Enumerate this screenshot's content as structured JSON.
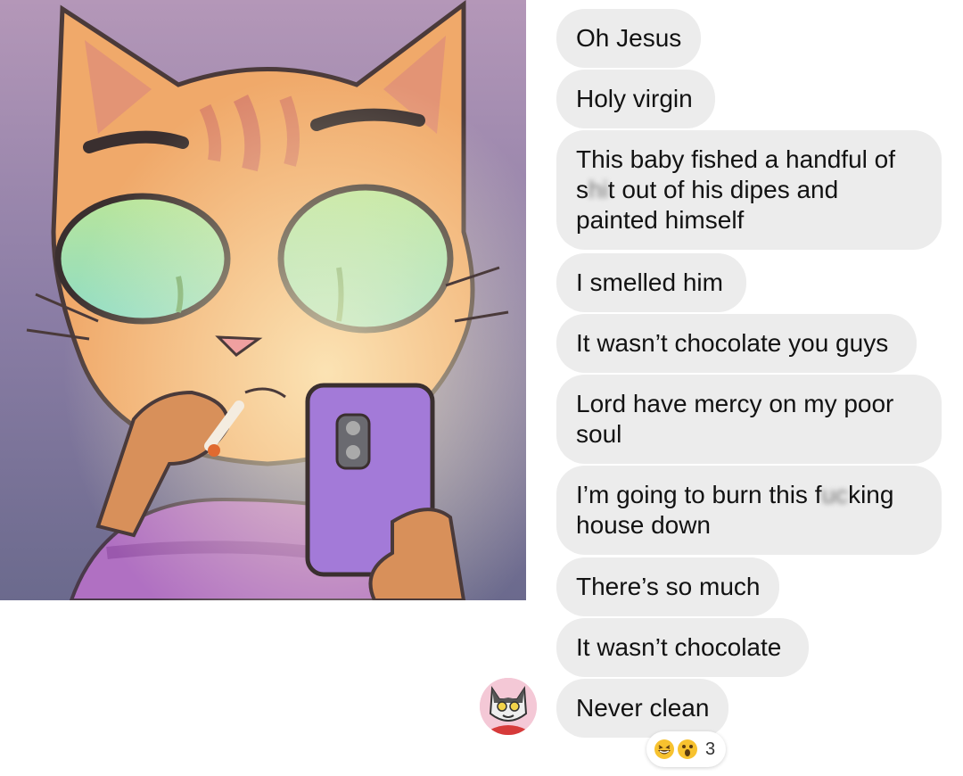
{
  "messages": [
    {
      "text": "Oh Jesus"
    },
    {
      "text": "Holy virgin"
    },
    {
      "line1": "This baby fished a handful of",
      "line2_pre": "s",
      "line2_blur": "hi",
      "line2_post": "t out of his dipes and",
      "line3": "painted himself"
    },
    {
      "text": "I smelled him"
    },
    {
      "text": "It wasn’t chocolate you guys"
    },
    {
      "line1": "Lord have mercy on my poor",
      "line2": "soul"
    },
    {
      "line1_pre": "I’m going to burn this f",
      "line1_blur": "uc",
      "line1_post": "king",
      "line2": "house down"
    },
    {
      "text": "There’s so much"
    },
    {
      "text": "It wasn’t chocolate"
    },
    {
      "text": "Never clean"
    }
  ],
  "reactions": {
    "emojis": [
      "grinning-squinting-face",
      "astonished-face"
    ],
    "count": "3"
  },
  "colors": {
    "bubble_bg": "#ececec",
    "text": "#121212",
    "avatar_bg": "#f4c8d6"
  },
  "images": {
    "artwork": "cartoon orange tabby cat smoking a cigarette and holding a purple phone",
    "avatar": "cartoon gray and white cat avatar"
  }
}
